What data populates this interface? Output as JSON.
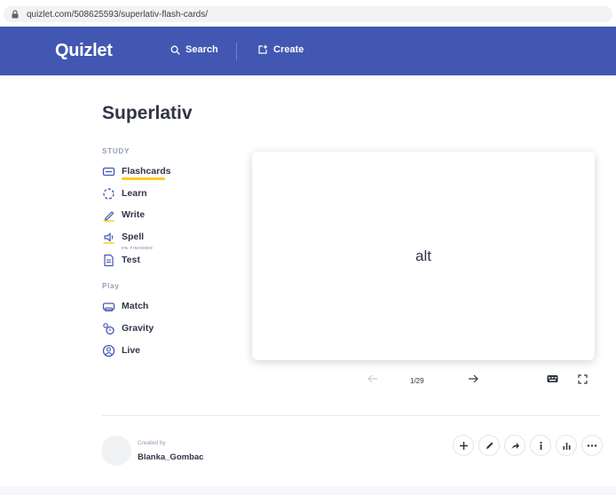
{
  "browser": {
    "url": "quizlet.com/508625593/superlativ-flash-cards/"
  },
  "nav": {
    "logo": "Quizlet",
    "search_label": "Search",
    "create_label": "Create"
  },
  "set": {
    "title": "Superlativ"
  },
  "sidebar": {
    "study_heading": "STUDY",
    "study_items": [
      {
        "label": "Flashcards",
        "icon": "flashcards-icon",
        "active": true
      },
      {
        "label": "Learn",
        "icon": "learn-icon"
      },
      {
        "label": "Write",
        "icon": "write-icon"
      },
      {
        "label": "Spell",
        "icon": "spell-icon",
        "sublabel": "0% FINISHED"
      },
      {
        "label": "Test",
        "icon": "test-icon"
      }
    ],
    "play_heading": "Play",
    "play_items": [
      {
        "label": "Match",
        "icon": "match-icon"
      },
      {
        "label": "Gravity",
        "icon": "gravity-icon"
      },
      {
        "label": "Live",
        "icon": "live-icon"
      }
    ]
  },
  "card": {
    "term": "alt"
  },
  "controls": {
    "counter": "1/29"
  },
  "creator": {
    "created_by_label": "Created by",
    "name": "Blanka_Gombac"
  },
  "colors": {
    "brand": "#4257b2",
    "accent": "#ffcd1f"
  }
}
